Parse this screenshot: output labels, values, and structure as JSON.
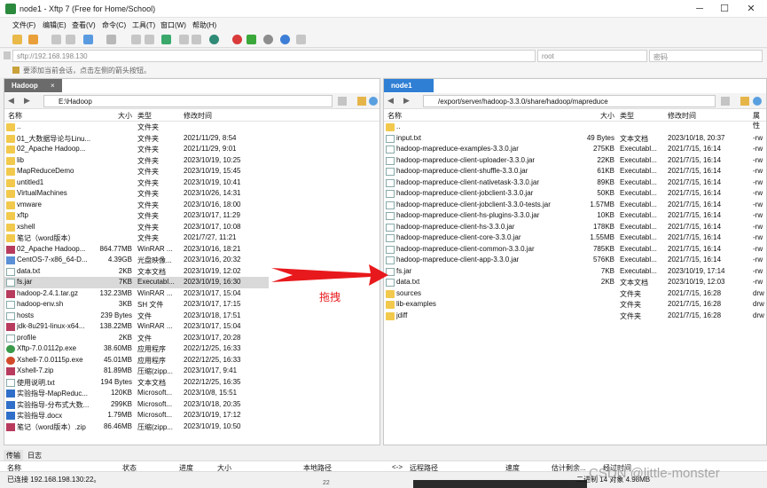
{
  "window": {
    "title": "node1 - Xftp 7 (Free for Home/School)"
  },
  "menu": [
    "文件(F)",
    "编辑(E)",
    "查看(V)",
    "命令(C)",
    "工具(T)",
    "窗口(W)",
    "帮助(H)"
  ],
  "address": {
    "host_placeholder": "sftp://192.168.198.130",
    "user_placeholder": "root",
    "password_placeholder": "密码"
  },
  "hint": "要添加当前会话，点击左侧的箭头按钮。",
  "left": {
    "tab": "Hadoop",
    "path": "E:\\Hadoop",
    "columns": [
      "名称",
      "大小",
      "类型",
      "修改时间"
    ],
    "rows": [
      {
        "icon": "folder",
        "name": "..",
        "size": "",
        "type": "文件夹",
        "date": ""
      },
      {
        "icon": "folder",
        "name": "01_大数据导论与Linu...",
        "size": "",
        "type": "文件夹",
        "date": "2021/11/29, 8:54"
      },
      {
        "icon": "folder",
        "name": "02_Apache Hadoop...",
        "size": "",
        "type": "文件夹",
        "date": "2021/11/29, 9:01"
      },
      {
        "icon": "folder",
        "name": "lib",
        "size": "",
        "type": "文件夹",
        "date": "2023/10/19, 10:25"
      },
      {
        "icon": "folder",
        "name": "MapReduceDemo",
        "size": "",
        "type": "文件夹",
        "date": "2023/10/19, 15:45"
      },
      {
        "icon": "folder",
        "name": "untitled1",
        "size": "",
        "type": "文件夹",
        "date": "2023/10/19, 10:41"
      },
      {
        "icon": "folder",
        "name": "VirtualMachines",
        "size": "",
        "type": "文件夹",
        "date": "2023/10/26, 14:31"
      },
      {
        "icon": "folder",
        "name": "vmware",
        "size": "",
        "type": "文件夹",
        "date": "2023/10/16, 18:00"
      },
      {
        "icon": "folder",
        "name": "xftp",
        "size": "",
        "type": "文件夹",
        "date": "2023/10/17, 11:29"
      },
      {
        "icon": "folder",
        "name": "xshell",
        "size": "",
        "type": "文件夹",
        "date": "2023/10/17, 10:08"
      },
      {
        "icon": "folder",
        "name": "笔记（word版本）",
        "size": "",
        "type": "文件夹",
        "date": "2021/7/27, 11:21"
      },
      {
        "icon": "archive",
        "name": "02_Apache Hadoop...",
        "size": "864.77MB",
        "type": "WinRAR ...",
        "date": "2023/10/16, 18:21"
      },
      {
        "icon": "img",
        "name": "CentOS-7-x86_64-D...",
        "size": "4.39GB",
        "type": "光盘映像...",
        "date": "2023/10/16, 20:32"
      },
      {
        "icon": "file",
        "name": "data.txt",
        "size": "2KB",
        "type": "文本文档",
        "date": "2023/10/19, 12:02"
      },
      {
        "icon": "file",
        "name": "fs.jar",
        "size": "7KB",
        "type": "Executabl...",
        "date": "2023/10/19, 16:30",
        "selected": true
      },
      {
        "icon": "archive",
        "name": "hadoop-2.4.1.tar.gz",
        "size": "132.23MB",
        "type": "WinRAR ...",
        "date": "2023/10/17, 15:04"
      },
      {
        "icon": "file",
        "name": "hadoop-env.sh",
        "size": "3KB",
        "type": "SH 文件",
        "date": "2023/10/17, 17:15"
      },
      {
        "icon": "file",
        "name": "hosts",
        "size": "239 Bytes",
        "type": "文件",
        "date": "2023/10/18, 17:51"
      },
      {
        "icon": "archive",
        "name": "jdk-8u291-linux-x64...",
        "size": "138.22MB",
        "type": "WinRAR ...",
        "date": "2023/10/17, 15:04"
      },
      {
        "icon": "file",
        "name": "profile",
        "size": "2KB",
        "type": "文件",
        "date": "2023/10/17, 20:28"
      },
      {
        "icon": "exe",
        "name": "Xftp-7.0.0112p.exe",
        "size": "38.60MB",
        "type": "应用程序",
        "date": "2022/12/25, 16:33"
      },
      {
        "icon": "exe2",
        "name": "Xshell-7.0.0115p.exe",
        "size": "45.01MB",
        "type": "应用程序",
        "date": "2022/12/25, 16:33"
      },
      {
        "icon": "archive",
        "name": "Xshell-7.zip",
        "size": "81.89MB",
        "type": "压缩(zipp...",
        "date": "2023/10/17, 9:41"
      },
      {
        "icon": "file",
        "name": "使用说明.txt",
        "size": "194 Bytes",
        "type": "文本文档",
        "date": "2022/12/25, 16:35"
      },
      {
        "icon": "doc",
        "name": "实验指导-MapReduc...",
        "size": "120KB",
        "type": "Microsoft...",
        "date": "2023/10/8, 15:51"
      },
      {
        "icon": "doc",
        "name": "实验指导-分布式大数...",
        "size": "299KB",
        "type": "Microsoft...",
        "date": "2023/10/18, 20:35"
      },
      {
        "icon": "doc",
        "name": "实验指导.docx",
        "size": "1.79MB",
        "type": "Microsoft...",
        "date": "2023/10/19, 17:12"
      },
      {
        "icon": "archive",
        "name": "笔记（word版本）.zip",
        "size": "86.46MB",
        "type": "压缩(zipp...",
        "date": "2023/10/19, 10:50"
      }
    ]
  },
  "right": {
    "tab": "node1",
    "path": "/export/server/hadoop-3.3.0/share/hadoop/mapreduce",
    "columns": [
      "名称",
      "大小",
      "类型",
      "修改时间",
      "属性"
    ],
    "rows": [
      {
        "icon": "folder",
        "name": "..",
        "size": "",
        "type": "",
        "date": "",
        "attr": ""
      },
      {
        "icon": "file",
        "name": "input.txt",
        "size": "49 Bytes",
        "type": "文本文档",
        "date": "2023/10/18, 20:37",
        "attr": "-rw"
      },
      {
        "icon": "file",
        "name": "hadoop-mapreduce-examples-3.3.0.jar",
        "size": "275KB",
        "type": "Executabl...",
        "date": "2021/7/15, 16:14",
        "attr": "-rw"
      },
      {
        "icon": "file",
        "name": "hadoop-mapreduce-client-uploader-3.3.0.jar",
        "size": "22KB",
        "type": "Executabl...",
        "date": "2021/7/15, 16:14",
        "attr": "-rw"
      },
      {
        "icon": "file",
        "name": "hadoop-mapreduce-client-shuffle-3.3.0.jar",
        "size": "61KB",
        "type": "Executabl...",
        "date": "2021/7/15, 16:14",
        "attr": "-rw"
      },
      {
        "icon": "file",
        "name": "hadoop-mapreduce-client-nativetask-3.3.0.jar",
        "size": "89KB",
        "type": "Executabl...",
        "date": "2021/7/15, 16:14",
        "attr": "-rw"
      },
      {
        "icon": "file",
        "name": "hadoop-mapreduce-client-jobclient-3.3.0.jar",
        "size": "50KB",
        "type": "Executabl...",
        "date": "2021/7/15, 16:14",
        "attr": "-rw"
      },
      {
        "icon": "file",
        "name": "hadoop-mapreduce-client-jobclient-3.3.0-tests.jar",
        "size": "1.57MB",
        "type": "Executabl...",
        "date": "2021/7/15, 16:14",
        "attr": "-rw"
      },
      {
        "icon": "file",
        "name": "hadoop-mapreduce-client-hs-plugins-3.3.0.jar",
        "size": "10KB",
        "type": "Executabl...",
        "date": "2021/7/15, 16:14",
        "attr": "-rw"
      },
      {
        "icon": "file",
        "name": "hadoop-mapreduce-client-hs-3.3.0.jar",
        "size": "178KB",
        "type": "Executabl...",
        "date": "2021/7/15, 16:14",
        "attr": "-rw"
      },
      {
        "icon": "file",
        "name": "hadoop-mapreduce-client-core-3.3.0.jar",
        "size": "1.55MB",
        "type": "Executabl...",
        "date": "2021/7/15, 16:14",
        "attr": "-rw"
      },
      {
        "icon": "file",
        "name": "hadoop-mapreduce-client-common-3.3.0.jar",
        "size": "785KB",
        "type": "Executabl...",
        "date": "2021/7/15, 16:14",
        "attr": "-rw"
      },
      {
        "icon": "file",
        "name": "hadoop-mapreduce-client-app-3.3.0.jar",
        "size": "576KB",
        "type": "Executabl...",
        "date": "2021/7/15, 16:14",
        "attr": "-rw"
      },
      {
        "icon": "file",
        "name": "fs.jar",
        "size": "7KB",
        "type": "Executabl...",
        "date": "2023/10/19, 17:14",
        "attr": "-rw"
      },
      {
        "icon": "file",
        "name": "data.txt",
        "size": "2KB",
        "type": "文本文档",
        "date": "2023/10/19, 12:03",
        "attr": "-rw"
      },
      {
        "icon": "folder",
        "name": "sources",
        "size": "",
        "type": "文件夹",
        "date": "2021/7/15, 16:28",
        "attr": "drw"
      },
      {
        "icon": "folder",
        "name": "lib-examples",
        "size": "",
        "type": "文件夹",
        "date": "2021/7/15, 16:28",
        "attr": "drw"
      },
      {
        "icon": "folder",
        "name": "jdiff",
        "size": "",
        "type": "文件夹",
        "date": "2021/7/15, 16:28",
        "attr": "drw"
      }
    ]
  },
  "annotation": {
    "label": "拖拽",
    "color": "#e8191c"
  },
  "transfers": {
    "tabs": [
      "传输",
      "日志"
    ],
    "columns": [
      "名称",
      "状态",
      "进度",
      "大小",
      "本地路径",
      "<->",
      "远程路径",
      "速度",
      "估计剩余...",
      "经过时间"
    ]
  },
  "status": {
    "left": "已连接 192.168.198.130:22。",
    "mid": "22",
    "right": "二进制  14 对象  4.98MB"
  },
  "watermark": "CSDN @little-monster",
  "colors": {
    "tab_left": "#6b6b6b",
    "tab_right": "#2f7fd4",
    "selection": "#d9d9d9"
  }
}
